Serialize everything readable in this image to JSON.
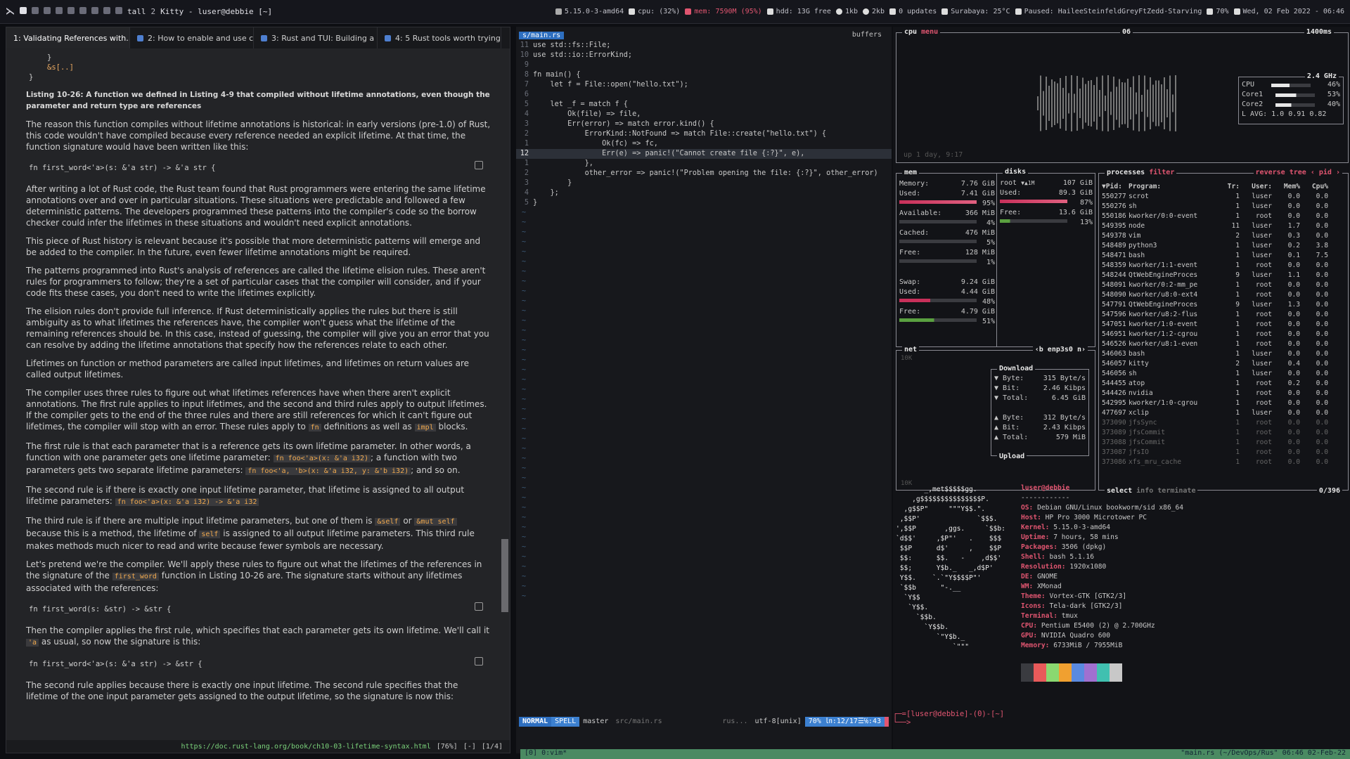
{
  "topbar": {
    "workspaces": [
      "1",
      "2",
      "3",
      "4",
      "5",
      "6",
      "7",
      "8",
      "9"
    ],
    "layout": "tall",
    "ws_count": "2",
    "title": "Kitty - luser@debbie [~]",
    "kernel": "5.15.0-3-amd64",
    "cpu": "cpu: (32%)",
    "mem": "mem: 7590M (95%)",
    "hdd": "hdd: 13G free",
    "net_up": "1kb",
    "net_down": "2kb",
    "updates": "0 updates",
    "weather": "Surabaya: 25°C",
    "music": "Paused: HaileeSteinfeldGreyFtZedd-Starving",
    "volume": "70%",
    "date": "Wed, 02 Feb 2022 - 06:46"
  },
  "browser": {
    "tabs": [
      "1: Validating References with...",
      "2: How to enable and use cod...",
      "3: Rust and TUI: Building a co...",
      "4: 5 Rust tools worth trying o..."
    ],
    "code_tail": [
      "}",
      "&s[..]",
      "}"
    ],
    "caption": "Listing 10-26: A function we defined in Listing 4-9 that compiled without lifetime annotations, even though the parameter and return type are references",
    "p1": "The reason this function compiles without lifetime annotations is historical: in early versions (pre-1.0) of Rust, this code wouldn't have compiled because every reference needed an explicit lifetime. At that time, the function signature would have been written like this:",
    "code1": "fn first_word<'a>(s: &'a str) -> &'a str {",
    "p2": "After writing a lot of Rust code, the Rust team found that Rust programmers were entering the same lifetime annotations over and over in particular situations. These situations were predictable and followed a few deterministic patterns. The developers programmed these patterns into the compiler's code so the borrow checker could infer the lifetimes in these situations and wouldn't need explicit annotations.",
    "p3": "This piece of Rust history is relevant because it's possible that more deterministic patterns will emerge and be added to the compiler. In the future, even fewer lifetime annotations might be required.",
    "p4": "The patterns programmed into Rust's analysis of references are called the lifetime elision rules. These aren't rules for programmers to follow; they're a set of particular cases that the compiler will consider, and if your code fits these cases, you don't need to write the lifetimes explicitly.",
    "p5": "The elision rules don't provide full inference. If Rust deterministically applies the rules but there is still ambiguity as to what lifetimes the references have, the compiler won't guess what the lifetime of the remaining references should be. In this case, instead of guessing, the compiler will give you an error that you can resolve by adding the lifetime annotations that specify how the references relate to each other.",
    "p6": "Lifetimes on function or method parameters are called input lifetimes, and lifetimes on return values are called output lifetimes.",
    "p7a": "The compiler uses three rules to figure out what lifetimes references have when there aren't explicit annotations. The first rule applies to input lifetimes, and the second and third rules apply to output lifetimes. If the compiler gets to the end of the three rules and there are still references for which it can't figure out lifetimes, the compiler will stop with an error. These rules apply to",
    "p7b": "definitions as well as",
    "p7c": "blocks.",
    "fn_kw": "fn",
    "impl_kw": "impl",
    "p8a": "The first rule is that each parameter that is a reference gets its own lifetime parameter. In other words, a function with one parameter gets one lifetime parameter:",
    "ex1": "fn foo<'a>(x: &'a i32)",
    "p8b": "; a function with two parameters gets two separate lifetime parameters:",
    "ex2": "fn foo<'a, 'b>(x: &'a i32, y: &'b i32)",
    "p8c": "; and so on.",
    "p9a": "The second rule is if there is exactly one input lifetime parameter, that lifetime is assigned to all output lifetime parameters:",
    "ex3": "fn foo<'a>(x: &'a i32) -> &'a i32",
    "p10a": "The third rule is if there are multiple input lifetime parameters, but one of them is",
    "self1": "&self",
    "or": "or",
    "self2": "&mut self",
    "p10b": "because this is a method, the lifetime of",
    "self3": "self",
    "p10c": "is assigned to all output lifetime parameters. This third rule makes methods much nicer to read and write because fewer symbols are necessary.",
    "p11a": "Let's pretend we're the compiler. We'll apply these rules to figure out what the lifetimes of the references in the signature of the",
    "fw": "first_word",
    "p11b": "function in Listing 10-26 are. The signature starts without any lifetimes associated with the references:",
    "code2": "fn first_word(s: &str) -> &str {",
    "p12a": "Then the compiler applies the first rule, which specifies that each parameter gets its own lifetime. We'll call it",
    "a": "'a",
    "p12b": "as usual, so now the signature is this:",
    "code3": "fn first_word<'a>(s: &'a str) -> &str {",
    "p13": "The second rule applies because there is exactly one input lifetime. The second rule specifies that the lifetime of the one input parameter gets assigned to the output lifetime, so the signature is now this:",
    "url": "https://doc.rust-lang.org/book/ch10-03-lifetime-syntax.html",
    "pct": "[76%]",
    "flags": "[-]",
    "pos": "[1/4]"
  },
  "vim": {
    "bufname": "s/main.rs",
    "buffers": "buffers",
    "lines": [
      [
        "11",
        "use std::fs::File;"
      ],
      [
        "10",
        "use std::io::ErrorKind;"
      ],
      [
        "9",
        ""
      ],
      [
        "8",
        "fn main() {"
      ],
      [
        "7",
        "    let f = File::open(\"hello.txt\");"
      ],
      [
        "6",
        ""
      ],
      [
        "5",
        "    let _f = match f {"
      ],
      [
        "4",
        "        Ok(file) => file,"
      ],
      [
        "3",
        "        Err(error) => match error.kind() {"
      ],
      [
        "2",
        "            ErrorKind::NotFound => match File::create(\"hello.txt\") {"
      ],
      [
        "1",
        "                Ok(fc) => fc,"
      ],
      [
        "12",
        "                Err(e) => panic!(\"Cannot create file {:?}\", e),"
      ],
      [
        "1",
        "            },"
      ],
      [
        "2",
        "            other_error => panic!(\"Problem opening the file: {:?}\", other_error)"
      ],
      [
        "3",
        "        }"
      ],
      [
        "4",
        "    };"
      ],
      [
        "5",
        "}"
      ]
    ],
    "mode": "NORMAL",
    "spell": "SPELL",
    "branch": "master",
    "file": "src/main.rs",
    "ft": "rus...",
    "enc": "utf-8[unix]",
    "pos": "70% ㏑:12/17☰℅:43",
    "cmd": "[0] 0:vim*",
    "session": "\"main.rs (~/DevOps/Rus\" 06:46 02-Feb-22"
  },
  "btop": {
    "cpu_label": "cpu",
    "menu": "menu",
    "ms": "1400ms",
    "refresh_n": "06",
    "uptime": "up 1 day, 9:17",
    "freq": "2.4 GHz",
    "cores": [
      [
        "CPU",
        "46%",
        0.46
      ],
      [
        "Core1",
        "53%",
        0.53
      ],
      [
        "Core2",
        "40%",
        0.4
      ]
    ],
    "lavg": "L AVG:  1.0 0.91 0.82",
    "mem": {
      "label": "mem",
      "memory": "7.76 GiB",
      "used": "7.41 GiB",
      "used_p": "95%",
      "avail": "366 MiB",
      "avail_p": "4%",
      "cached": "476 MiB",
      "cached_p": "5%",
      "free": "128 MiB",
      "free_p": "1%",
      "swap": "9.24 GiB",
      "sused": "4.44 GiB",
      "sused_p": "48%",
      "sfree": "4.79 GiB",
      "sfree_p": "51%"
    },
    "disks": {
      "label": "disks",
      "root": "root",
      "root_io": "▼▲1M",
      "total": "107 GiB",
      "used": "89.3 GiB",
      "used_p": "87%",
      "free": "13.6 GiB",
      "free_p": "13%"
    },
    "net": {
      "label": "net",
      "iface": "‹b enp3s0 n›",
      "scale_top": "10K",
      "scale_bot": "10K",
      "download": "Download",
      "upload": "Upload",
      "d": [
        [
          "▼ Byte:",
          "315 Byte/s"
        ],
        [
          "▼ Bit:",
          "2.46 Kibps"
        ],
        [
          "▼ Total:",
          "6.45 GiB"
        ]
      ],
      "u": [
        [
          "▲ Byte:",
          "312 Byte/s"
        ],
        [
          "▲ Bit:",
          "2.43 Kibps"
        ],
        [
          "▲ Total:",
          "579 MiB"
        ]
      ]
    },
    "proc": {
      "label": "processes",
      "filter": "filter",
      "reverse": "reverse",
      "tree": "tree",
      "sort": "‹ pid ›",
      "headers": [
        "▼Pid:",
        "Program:",
        "Tr:",
        "User:",
        "Mem%",
        "Cpu%"
      ],
      "rows": [
        [
          "550277",
          "scrot",
          "1",
          "luser",
          "0.0",
          "0.0"
        ],
        [
          "550276",
          "sh",
          "1",
          "luser",
          "0.0",
          "0.0"
        ],
        [
          "550186",
          "kworker/0:0-event",
          "1",
          "root",
          "0.0",
          "0.0"
        ],
        [
          "549395",
          "node",
          "11",
          "luser",
          "1.7",
          "0.0"
        ],
        [
          "549378",
          "vim",
          "2",
          "luser",
          "0.3",
          "0.0"
        ],
        [
          "548489",
          "python3",
          "1",
          "luser",
          "0.2",
          "3.8"
        ],
        [
          "548471",
          "bash",
          "1",
          "luser",
          "0.1",
          "7.5"
        ],
        [
          "548359",
          "kworker/1:1-event",
          "1",
          "root",
          "0.0",
          "0.0"
        ],
        [
          "548244",
          "QtWebEngineProces",
          "9",
          "luser",
          "1.1",
          "0.0"
        ],
        [
          "548091",
          "kworker/0:2-mm_pe",
          "1",
          "root",
          "0.0",
          "0.0"
        ],
        [
          "548090",
          "kworker/u8:0-ext4",
          "1",
          "root",
          "0.0",
          "0.0"
        ],
        [
          "547791",
          "QtWebEngineProces",
          "9",
          "luser",
          "1.3",
          "0.0"
        ],
        [
          "547596",
          "kworker/u8:2-flus",
          "1",
          "root",
          "0.0",
          "0.0"
        ],
        [
          "547051",
          "kworker/1:0-event",
          "1",
          "root",
          "0.0",
          "0.0"
        ],
        [
          "546951",
          "kworker/1:2-cgrou",
          "1",
          "root",
          "0.0",
          "0.0"
        ],
        [
          "546526",
          "kworker/u8:1-even",
          "1",
          "root",
          "0.0",
          "0.0"
        ],
        [
          "546063",
          "bash",
          "1",
          "luser",
          "0.0",
          "0.0"
        ],
        [
          "546057",
          "kitty",
          "2",
          "luser",
          "0.4",
          "0.0"
        ],
        [
          "546056",
          "sh",
          "1",
          "luser",
          "0.0",
          "0.0"
        ],
        [
          "544455",
          "atop",
          "1",
          "root",
          "0.2",
          "0.0"
        ],
        [
          "544426",
          "nvidia",
          "1",
          "root",
          "0.0",
          "0.0"
        ],
        [
          "542995",
          "kworker/1:0-cgrou",
          "1",
          "root",
          "0.0",
          "0.0"
        ],
        [
          "477697",
          "xclip",
          "1",
          "luser",
          "0.0",
          "0.0"
        ],
        [
          "373090",
          "jfsSync",
          "1",
          "root",
          "0.0",
          "0.0"
        ],
        [
          "373089",
          "jfsCommit",
          "1",
          "root",
          "0.0",
          "0.0"
        ],
        [
          "373088",
          "jfsCommit",
          "1",
          "root",
          "0.0",
          "0.0"
        ],
        [
          "373087",
          "jfsIO",
          "1",
          "root",
          "0.0",
          "0.0"
        ],
        [
          "373086",
          "xfs_mru_cache",
          "1",
          "root",
          "0.0",
          "0.0"
        ]
      ],
      "select": "select",
      "info": "info",
      "terminate": "terminate",
      "count": "0/396"
    }
  },
  "neofetch": {
    "user": "luser@debbie",
    "sep": "------------",
    "fields": [
      [
        "OS",
        "Debian GNU/Linux bookworm/sid x86_64"
      ],
      [
        "Host",
        "HP Pro 3000 Microtower PC"
      ],
      [
        "Kernel",
        "5.15.0-3-amd64"
      ],
      [
        "Uptime",
        "7 hours, 58 mins"
      ],
      [
        "Packages",
        "3506 (dpkg)"
      ],
      [
        "Shell",
        "bash 5.1.16"
      ],
      [
        "Resolution",
        "1920x1080"
      ],
      [
        "DE",
        "GNOME"
      ],
      [
        "WM",
        "XMonad"
      ],
      [
        "Theme",
        "Vortex-GTK [GTK2/3]"
      ],
      [
        "Icons",
        "Tela-dark [GTK2/3]"
      ],
      [
        "Terminal",
        "tmux"
      ],
      [
        "CPU",
        "Pentium E5400 (2) @ 2.700GHz"
      ],
      [
        "GPU",
        "NVIDIA Quadro 600"
      ],
      [
        "Memory",
        "6733MiB / 7955MiB"
      ]
    ],
    "swatches": [
      "#3a3b40",
      "#e85a5a",
      "#8ad870",
      "#f0a030",
      "#5a8ae0",
      "#a070d0",
      "#40c0b0",
      "#c8c8c8"
    ],
    "logo": [
      "       _,met$$$$$gg.",
      "    ,g$$$$$$$$$$$$$$$P.",
      "  ,g$$P\"     \"\"\"Y$$.\".",
      " ,$$P'              `$$$.",
      "',$$P       ,ggs.     `$$b:",
      "`d$$'     ,$P\"'   .    $$$",
      " $$P      d$'     ,    $$P",
      " $$:      $$.   -    ,d$$'",
      " $$;      Y$b._   _,d$P'",
      " Y$$.    `.`\"Y$$$$P\"'",
      " `$$b      \"-.__",
      "  `Y$$",
      "   `Y$$.",
      "     `$$b.",
      "       `Y$$b.",
      "          `\"Y$b._",
      "              `\"\"\""
    ],
    "prompt": "┌─=[luser@debbie]-(0)-[~]",
    "prompt2": "└──>"
  }
}
